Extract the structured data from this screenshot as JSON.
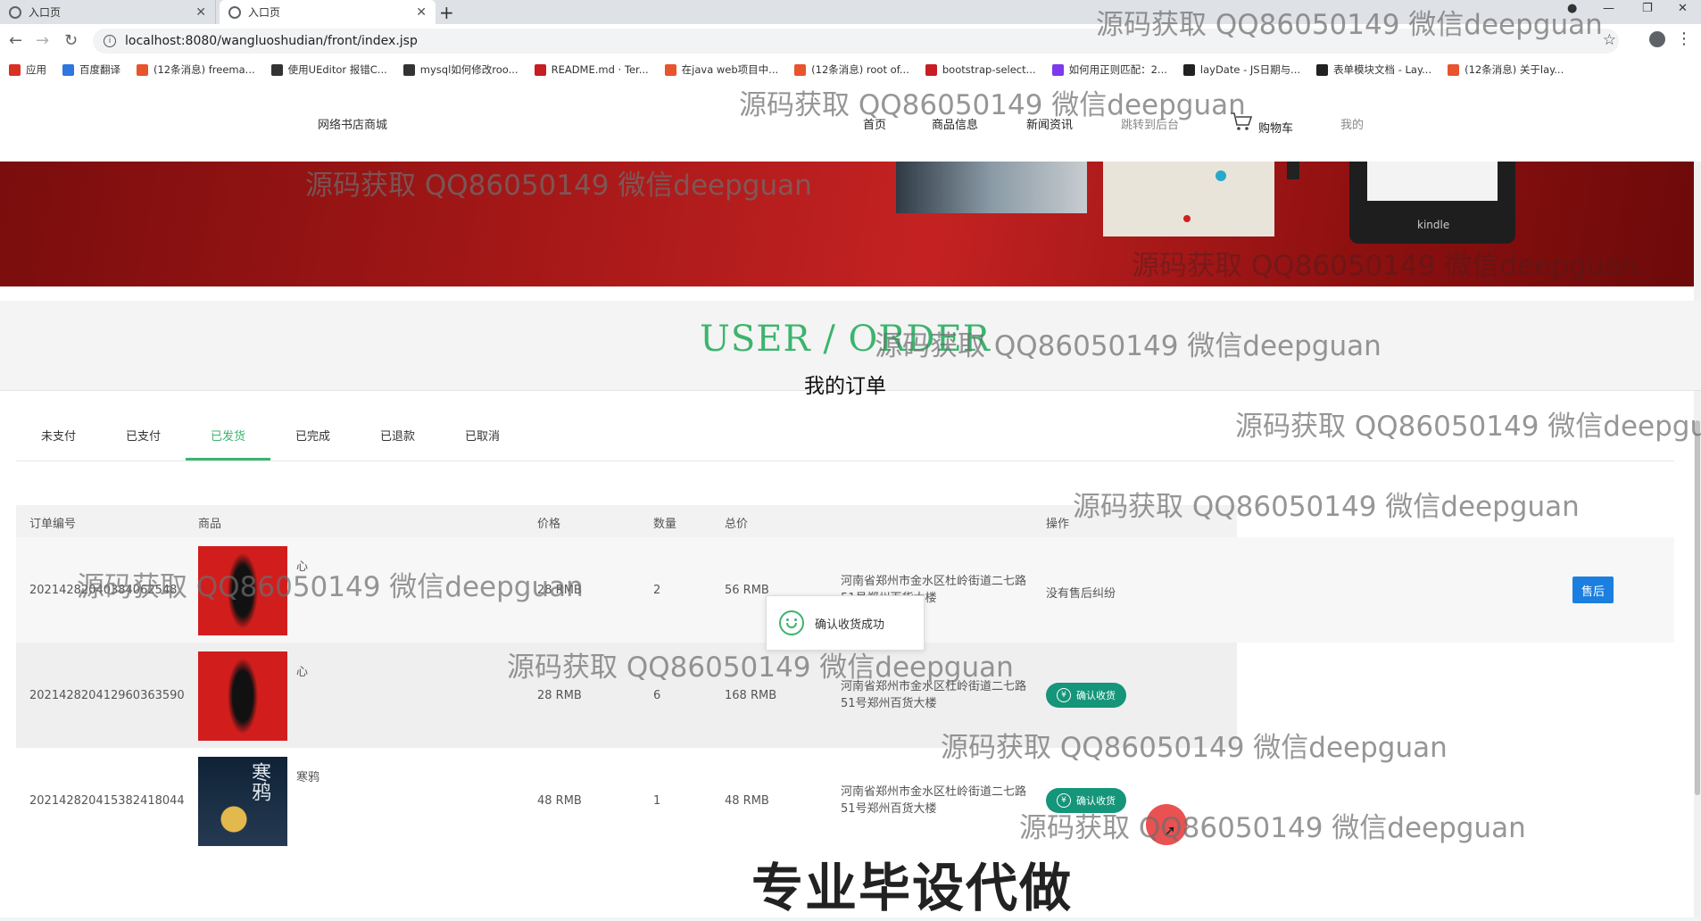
{
  "browser": {
    "tabs": [
      {
        "title": "入口页",
        "active": false
      },
      {
        "title": "入口页",
        "active": true
      }
    ],
    "new_tab": "+",
    "url": "localhost:8080/wangluoshudian/front/index.jsp",
    "bookmarks": [
      {
        "label": "应用",
        "color": "#d93025"
      },
      {
        "label": "百度翻译",
        "color": "#2f76e0"
      },
      {
        "label": "(12条消息) freema...",
        "color": "#e8542d"
      },
      {
        "label": "使用UEditor 报错C...",
        "color": "#333333"
      },
      {
        "label": "mysql如何修改roo...",
        "color": "#333333"
      },
      {
        "label": "README.md · Ter...",
        "color": "#c71d23"
      },
      {
        "label": "在java web项目中...",
        "color": "#e8542d"
      },
      {
        "label": "(12条消息) root of...",
        "color": "#e8542d"
      },
      {
        "label": "bootstrap-select...",
        "color": "#c71d23"
      },
      {
        "label": "如何用正则匹配：2...",
        "color": "#7c3aed"
      },
      {
        "label": "layDate - JS日期与...",
        "color": "#222222"
      },
      {
        "label": "表单模块文档 - Lay...",
        "color": "#222222"
      },
      {
        "label": "(12条消息) 关于lay...",
        "color": "#e8542d"
      }
    ]
  },
  "site": {
    "name": "网络书店商城",
    "nav": [
      "首页",
      "商品信息",
      "新闻资讯",
      "跳转到后台",
      "购物车",
      "我的"
    ]
  },
  "page": {
    "title_en": "USER / ORDER",
    "title_cn": "我的订单"
  },
  "order_tabs": [
    "未支付",
    "已支付",
    "已发货",
    "已完成",
    "已退款",
    "已取消"
  ],
  "active_tab": "已发货",
  "table": {
    "headers": [
      "订单编号",
      "商品",
      "价格",
      "数量",
      "总价",
      "操作"
    ],
    "rows": [
      {
        "order_no": "20214282040384062548",
        "product": "心",
        "price": "28 RMB",
        "qty": "2",
        "total": "56 RMB",
        "address": "河南省郑州市金水区杜岭街道二七路51号郑州百货大楼",
        "operation": "没有售后纠纷",
        "action": "售后"
      },
      {
        "order_no": "20214282041296036359​0",
        "product": "心",
        "price": "28 RMB",
        "qty": "6",
        "total": "168 RMB",
        "address": "河南省郑州市金水区杜岭街道二七路51号郑州百货大楼",
        "operation": "",
        "action": "确认收货"
      },
      {
        "order_no": "20214282041538241804​4",
        "product": "寒鸦",
        "price": "48 RMB",
        "qty": "1",
        "total": "48 RMB",
        "address": "河南省郑州市金水区杜岭街道二七路51号郑州百货大楼",
        "operation": "",
        "action": "确认收货"
      }
    ]
  },
  "toast": "确认收货成功",
  "cover_title_2": "寒鸦",
  "watermark": "源码获取 QQ86050149 微信deepguan",
  "promo": "专业毕设代做",
  "colors": {
    "accent": "#3cb46e",
    "confirm": "#15957a",
    "after_sale": "#1b7fe0"
  }
}
